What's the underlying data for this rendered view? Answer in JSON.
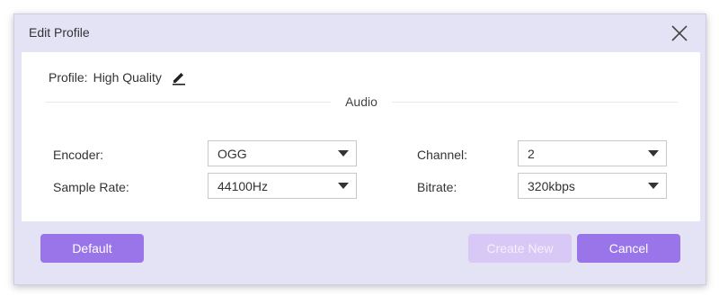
{
  "dialog": {
    "title": "Edit Profile",
    "close_icon": "close-icon"
  },
  "profile": {
    "label": "Profile:",
    "value": "High Quality",
    "edit_icon": "pencil-icon"
  },
  "section": {
    "title": "Audio"
  },
  "fields": {
    "encoder": {
      "label": "Encoder:",
      "value": "OGG"
    },
    "sample_rate": {
      "label": "Sample Rate:",
      "value": "44100Hz"
    },
    "channel": {
      "label": "Channel:",
      "value": "2"
    },
    "bitrate": {
      "label": "Bitrate:",
      "value": "320kbps"
    }
  },
  "buttons": {
    "default": "Default",
    "create_new": "Create New",
    "cancel": "Cancel"
  },
  "colors": {
    "accent": "#9a75ea",
    "accent_disabled": "#d7c8f6",
    "dialog_bg": "#e4e3f5"
  }
}
